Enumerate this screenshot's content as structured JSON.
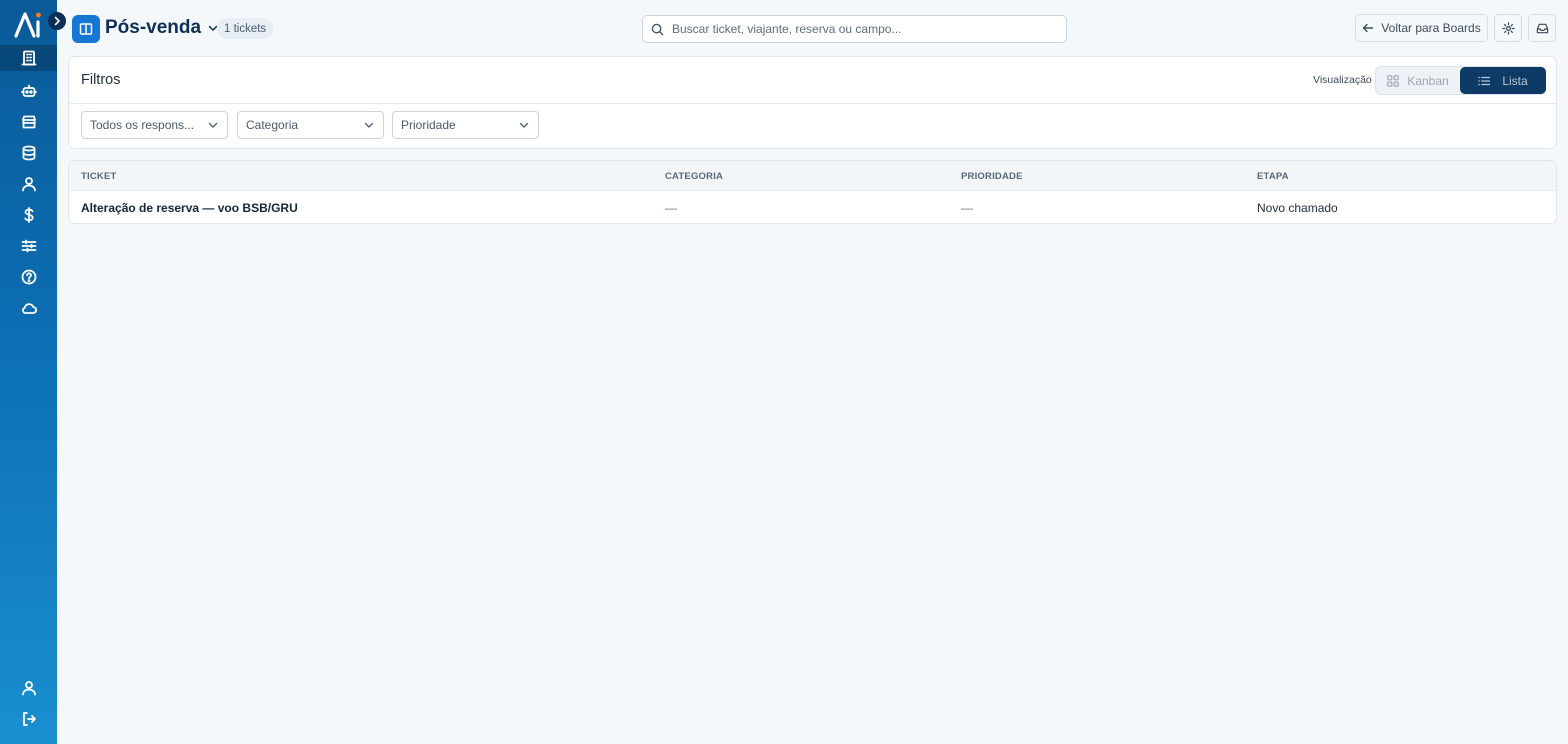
{
  "sidebar": {
    "logo_text": "AI",
    "nav": [
      {
        "name": "building-icon",
        "active": true
      },
      {
        "name": "robot-icon",
        "active": false
      },
      {
        "name": "store-icon",
        "active": false
      },
      {
        "name": "database-icon",
        "active": false
      },
      {
        "name": "user-icon",
        "active": false
      },
      {
        "name": "dollar-icon",
        "active": false
      },
      {
        "name": "sliders-icon",
        "active": false
      },
      {
        "name": "help-icon",
        "active": false
      },
      {
        "name": "cloud-icon",
        "active": false
      }
    ],
    "bottom": [
      {
        "name": "profile-icon"
      },
      {
        "name": "logout-icon"
      }
    ]
  },
  "header": {
    "board_title": "Pós-venda",
    "ticket_count": "1 tickets",
    "search_placeholder": "Buscar ticket, viajante, reserva ou campo...",
    "back_label": "Voltar para Boards"
  },
  "filters": {
    "title": "Filtros",
    "view_label": "Visualização",
    "view_kanban": "Kanban",
    "view_lista": "Lista",
    "selected_view": "Lista",
    "selects": [
      {
        "value": "Todos os respons..."
      },
      {
        "value": "Categoria"
      },
      {
        "value": "Prioridade"
      }
    ]
  },
  "table": {
    "columns": [
      "TICKET",
      "CATEGORIA",
      "PRIORIDADE",
      "ETAPA"
    ],
    "rows": [
      {
        "ticket": "Alteração de reserva — voo BSB/GRU",
        "categoria": "—",
        "prioridade": "—",
        "etapa": "Novo chamado"
      }
    ]
  },
  "colors": {
    "sidebar_top": "#0a5a98",
    "sidebar_bottom": "#1a8fd0",
    "accent": "#1677d2",
    "toggle_active": "#0e3a66",
    "logo_accent": "#ff7a1a"
  }
}
